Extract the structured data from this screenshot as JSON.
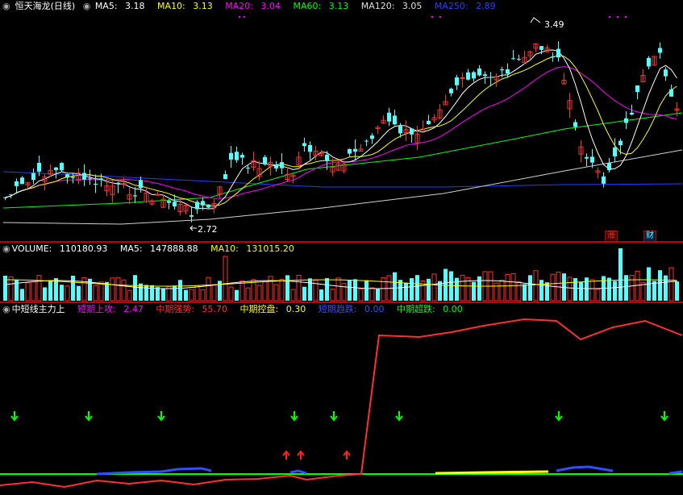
{
  "main": {
    "title": "恒天海龙(日线)",
    "indicators": [
      {
        "label": "MA5:",
        "value": "3.18",
        "color": "#ffffff"
      },
      {
        "label": "MA10:",
        "value": "3.13",
        "color": "#ffff00"
      },
      {
        "label": "MA20:",
        "value": "3.04",
        "color": "#ff00ff"
      },
      {
        "label": "MA60:",
        "value": "3.13",
        "color": "#00ff00"
      },
      {
        "label": "MA120:",
        "value": "3.05",
        "color": "#e0e0e0"
      },
      {
        "label": "MA250:",
        "value": "2.89",
        "color": "#2040ff"
      }
    ],
    "high_label": "3.49",
    "low_label": "2.72",
    "badge_up": "涨",
    "badge_fin": "财"
  },
  "volume": {
    "label": "VOLUME:",
    "value": "110180.93",
    "ma5_label": "MA5:",
    "ma5_value": "147888.88",
    "ma10_label": "MA10:",
    "ma10_value": "131015.20"
  },
  "indicator": {
    "name": "中短线主力上",
    "items": [
      {
        "label": "短期上攻:",
        "value": "2.47",
        "color": "#ff00ff"
      },
      {
        "label": "中期强势:",
        "value": "55.70",
        "color": "#ff3030"
      },
      {
        "label": "中期控盘:",
        "value": "0.30",
        "color": "#ffff00"
      },
      {
        "label": "短期趋跌:",
        "value": "0.00",
        "color": "#3050ff"
      },
      {
        "label": "中期超跌:",
        "value": "0.00",
        "color": "#00ff00"
      }
    ]
  },
  "colors": {
    "up": "#ff3030",
    "down": "#54ffff",
    "separator": "#c00000"
  },
  "icons": [
    "circle-marker-icon",
    "green-down-arrow-icon",
    "red-up-arrow-icon"
  ]
}
